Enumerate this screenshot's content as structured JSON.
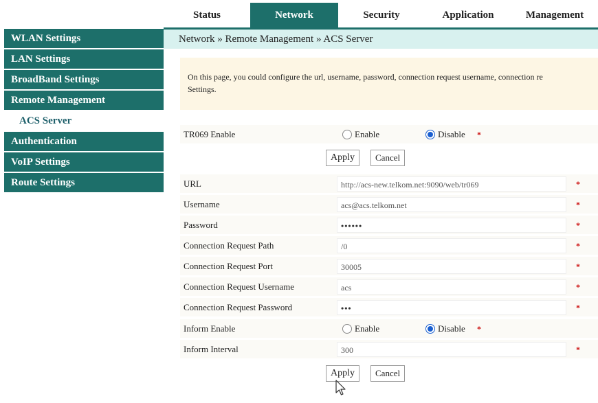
{
  "nav": {
    "tabs": [
      {
        "label": "Status"
      },
      {
        "label": "Network",
        "active": true
      },
      {
        "label": "Security"
      },
      {
        "label": "Application"
      },
      {
        "label": "Management"
      }
    ]
  },
  "sidebar": {
    "items": [
      {
        "label": "WLAN Settings"
      },
      {
        "label": "LAN Settings"
      },
      {
        "label": "BroadBand Settings"
      },
      {
        "label": "Remote Management"
      },
      {
        "label": "ACS Server",
        "sub": true
      },
      {
        "label": "Authentication"
      },
      {
        "label": "VoIP Settings"
      },
      {
        "label": "Route Settings"
      }
    ]
  },
  "breadcrumb": "Network » Remote Management » ACS Server",
  "info": {
    "line1": "On this page, you could configure the url, username, password, connection request username, connection re",
    "line2": "Settings."
  },
  "form": {
    "tr069": {
      "label": "TR069 Enable",
      "enable": "Enable",
      "disable": "Disable",
      "selected": "disable"
    },
    "apply_label": "Apply",
    "cancel_label": "Cancel",
    "url": {
      "label": "URL",
      "value": "http://acs-new.telkom.net:9090/web/tr069"
    },
    "username": {
      "label": "Username",
      "value": "acs@acs.telkom.net"
    },
    "password": {
      "label": "Password",
      "value": "••••••"
    },
    "conn_path": {
      "label": "Connection Request Path",
      "value": "/0"
    },
    "conn_port": {
      "label": "Connection Request Port",
      "value": "30005"
    },
    "conn_user": {
      "label": "Connection Request Username",
      "value": "acs"
    },
    "conn_pass": {
      "label": "Connection Request Password",
      "value": "•••"
    },
    "inform": {
      "label": "Inform Enable",
      "enable": "Enable",
      "disable": "Disable",
      "selected": "disable"
    },
    "interval": {
      "label": "Inform Interval",
      "value": "300"
    },
    "required_mark": "*"
  },
  "colors": {
    "accent": "#1d6f6a",
    "breadcrumb_bg": "#d8f1ef",
    "info_bg": "#fdf6e4",
    "required": "#cc1111",
    "radio": "#1a5fd0"
  }
}
